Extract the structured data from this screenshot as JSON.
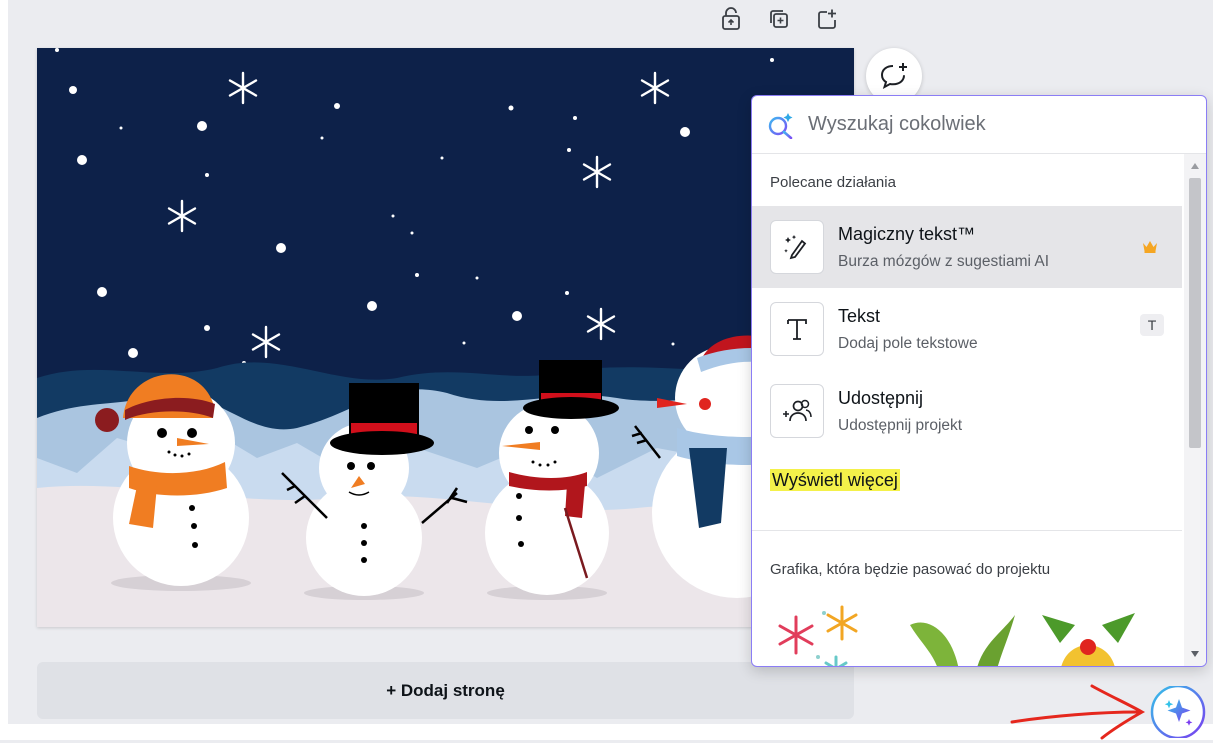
{
  "search": {
    "placeholder": "Wyszukaj cokolwiek"
  },
  "recommended": {
    "title": "Polecane działania",
    "items": [
      {
        "title": "Magiczny tekst™",
        "subtitle": "Burza mózgów z sugestiami AI",
        "icon": "magic-pen-icon",
        "badge": "crown-icon"
      },
      {
        "title": "Tekst",
        "subtitle": "Dodaj pole tekstowe",
        "icon": "text-icon",
        "shortcut": "T"
      },
      {
        "title": "Udostępnij",
        "subtitle": "Udostępnij projekt",
        "icon": "share-people-icon"
      }
    ],
    "see_more": "Wyświetl więcej"
  },
  "graphics_section": {
    "title": "Grafika, która będzie pasować do projektu"
  },
  "add_page": {
    "label": "+ Dodaj stronę"
  },
  "colors": {
    "accent": "#8b7df5",
    "highlight": "#f4f14a",
    "canvas_sky": "#0d2149",
    "annotation": "#e5271d"
  }
}
